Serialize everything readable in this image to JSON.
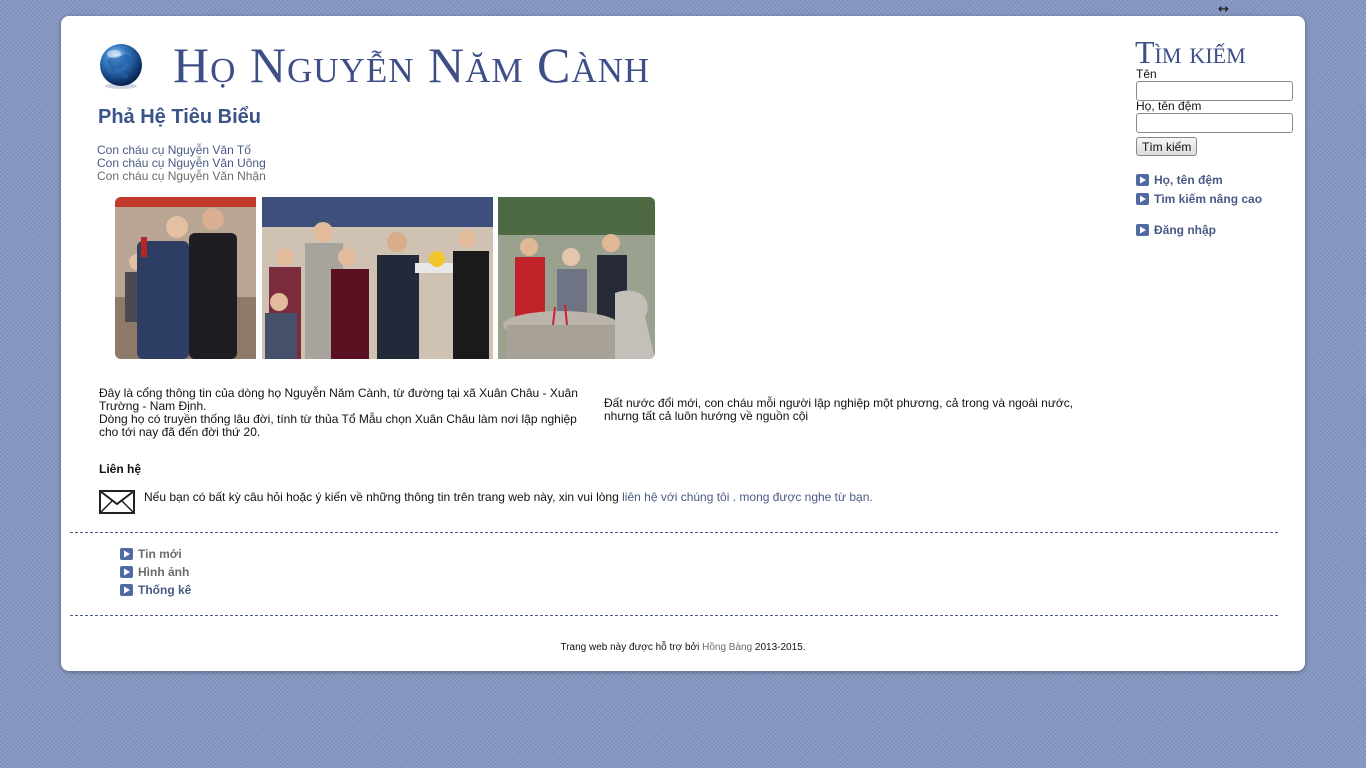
{
  "window": {
    "resize_icon": "↔"
  },
  "header": {
    "site_title": "Họ Nguyễn Năm Cành",
    "logo_icon": "globe-icon"
  },
  "main": {
    "section_title": "Phả Hệ Tiêu Biểu",
    "family_links": [
      "Con cháu cụ Nguyễn Văn Tố",
      "Con cháu cụ Nguyễn Văn Uông",
      "Con cháu cụ Nguyễn Văn Nhận"
    ],
    "intro_p1": "Đây là cổng thông tin của dòng họ Nguyễn Năm Cành, từ đường tại xã Xuân Châu - Xuân Trường - Nam Định.",
    "intro_p2": "Dòng họ có truyền thống lâu đời, tính từ thủa Tổ Mẫu chọn Xuân Châu làm nơi lập nghiệp cho tới nay đã đến đời thứ 20.",
    "intro_right": "Đất nước đổi mới, con cháu mỗi người lập nghiệp một phương, cả trong và ngoài nước, nhưng tất cả luôn hướng về nguồn cội",
    "contact_heading": "Liên hệ",
    "contact_text": "Nếu bạn có bất kỳ câu hỏi hoặc ý kiến về những thông tin trên trang web này, xin vui lòng",
    "contact_link": "liên hệ với chúng tôi . mong được nghe từ bạn."
  },
  "bottom_menu": [
    "Tin mới",
    "Hình ảnh",
    "Thống kê"
  ],
  "footer": {
    "prefix": "Trang web này được hỗ trợ bởi",
    "link": "Hồng Bàng",
    "suffix": "2013-2015."
  },
  "search": {
    "title": "Tìm kiếm",
    "first_name_label": "Tên",
    "surname_label": "Họ, tên đệm",
    "first_name_value": "",
    "surname_value": "",
    "button_label": "Tìm kiếm",
    "links": [
      "Họ, tên đệm",
      "Tìm kiếm nâng cao"
    ],
    "login_link": "Đăng nhập"
  },
  "colors": {
    "link": "#4a5a86",
    "title": "#3d4f86",
    "background": "#8596c0"
  }
}
